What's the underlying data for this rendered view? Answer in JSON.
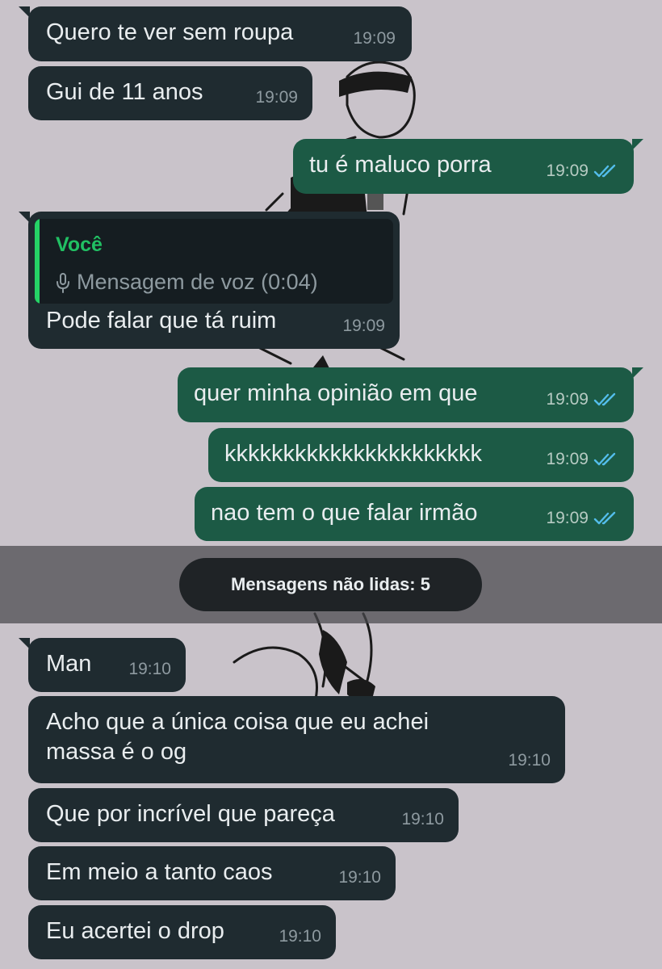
{
  "messages": [
    {
      "text": "Quero te ver sem roupa",
      "time": "19:09"
    },
    {
      "text": "Gui de 11 anos",
      "time": "19:09"
    },
    {
      "text": "tu é maluco porra",
      "time": "19:09"
    },
    {
      "quote_author": "Você",
      "quote_text": "Mensagem de voz (0:04)",
      "text": "Pode falar que tá ruim",
      "time": "19:09"
    },
    {
      "text": "quer minha opinião em que",
      "time": "19:09"
    },
    {
      "text": "kkkkkkkkkkkkkkkkkkkkkk",
      "time": "19:09"
    },
    {
      "text": "nao tem o que falar irmão",
      "time": "19:09"
    },
    {
      "text": "Man",
      "time": "19:10"
    },
    {
      "text": "Acho que a única coisa que eu achei massa é o og",
      "time": "19:10"
    },
    {
      "text": "Que por incrível que pareça",
      "time": "19:10"
    },
    {
      "text": "Em meio a tanto caos",
      "time": "19:10"
    },
    {
      "text": "Eu acertei o drop",
      "time": "19:10"
    }
  ],
  "unread_label": "Mensagens não lidas: 5",
  "icons": {
    "read_receipt": "double-check-icon",
    "voice": "mic-icon"
  },
  "colors": {
    "wallpaper": "#c9c3ca",
    "incoming_bubble": "#1f2b30",
    "outgoing_bubble": "#1c5a45",
    "read_ticks": "#53bdeb",
    "quote_accent": "#25d366"
  }
}
